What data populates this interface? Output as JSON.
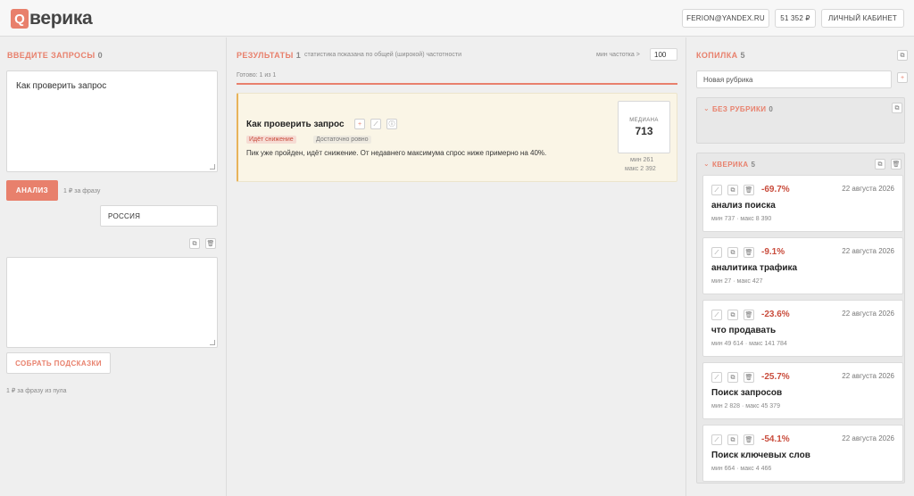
{
  "header": {
    "logo_letter": "Q",
    "logo_text": "верика",
    "email": "FERION@YANDEX.RU",
    "balance": "51 352 ₽",
    "cabinet": "ЛИЧНЫЙ КАБИНЕТ"
  },
  "left": {
    "title": "ВВЕДИТЕ ЗАПРОСЫ",
    "count": "0",
    "query_text": "Как проверить запрос",
    "analyze_label": "АНАЛИЗ",
    "price_note": "1 ₽ за фразу",
    "region": "РОССИЯ",
    "hints_label": "СОБРАТЬ ПОДСКАЗКИ",
    "pool_note": "1 ₽ за фразу из пула"
  },
  "mid": {
    "title": "РЕЗУЛЬТАТЫ",
    "count": "1",
    "subtitle": "статистика показана по общей (широкой) частотности",
    "min_freq_label": "мин частотка >",
    "min_freq_value": "100",
    "status": "Готово: 1 из 1",
    "result": {
      "query": "Как проверить запрос",
      "tag_trend": "Идёт снижение",
      "tag_evenness": "Достаточно ровно",
      "description": "Пик уже пройден, идёт снижение. От недавнего максимума спрос ниже примерно на 40%.",
      "median_label": "МЕДИАНА",
      "median_value": "713",
      "min": "мин 261",
      "max": "макс 2 392"
    }
  },
  "right": {
    "title": "КОПИЛКА",
    "count": "5",
    "new_rubric_placeholder": "Новая рубрика",
    "rubric_none": {
      "title": "БЕЗ РУБРИКИ",
      "count": "0"
    },
    "rubric_qverika": {
      "title": "КВЕРИКА",
      "count": "5"
    },
    "items": [
      {
        "pct": "-69.7%",
        "date": "22 августа 2026",
        "name": "анализ поиска",
        "stats": "мин 737 · макс 8 390"
      },
      {
        "pct": "-9.1%",
        "date": "22 августа 2026",
        "name": "аналитика трафика",
        "stats": "мин 27 · макс 427"
      },
      {
        "pct": "-23.6%",
        "date": "22 августа 2026",
        "name": "что продавать",
        "stats": "мин 49 614 · макс 141 784"
      },
      {
        "pct": "-25.7%",
        "date": "22 августа 2026",
        "name": "Поиск запросов",
        "stats": "мин 2 828 · макс 45 379"
      },
      {
        "pct": "-54.1%",
        "date": "22 августа 2026",
        "name": "Поиск ключевых слов",
        "stats": "мин 664 · макс 4 466"
      }
    ]
  },
  "icons": {
    "plus": "+",
    "chart": "⟋",
    "copy": "⧉",
    "trash": "🗑",
    "info": "ⓘ",
    "chevron": "⌄"
  }
}
